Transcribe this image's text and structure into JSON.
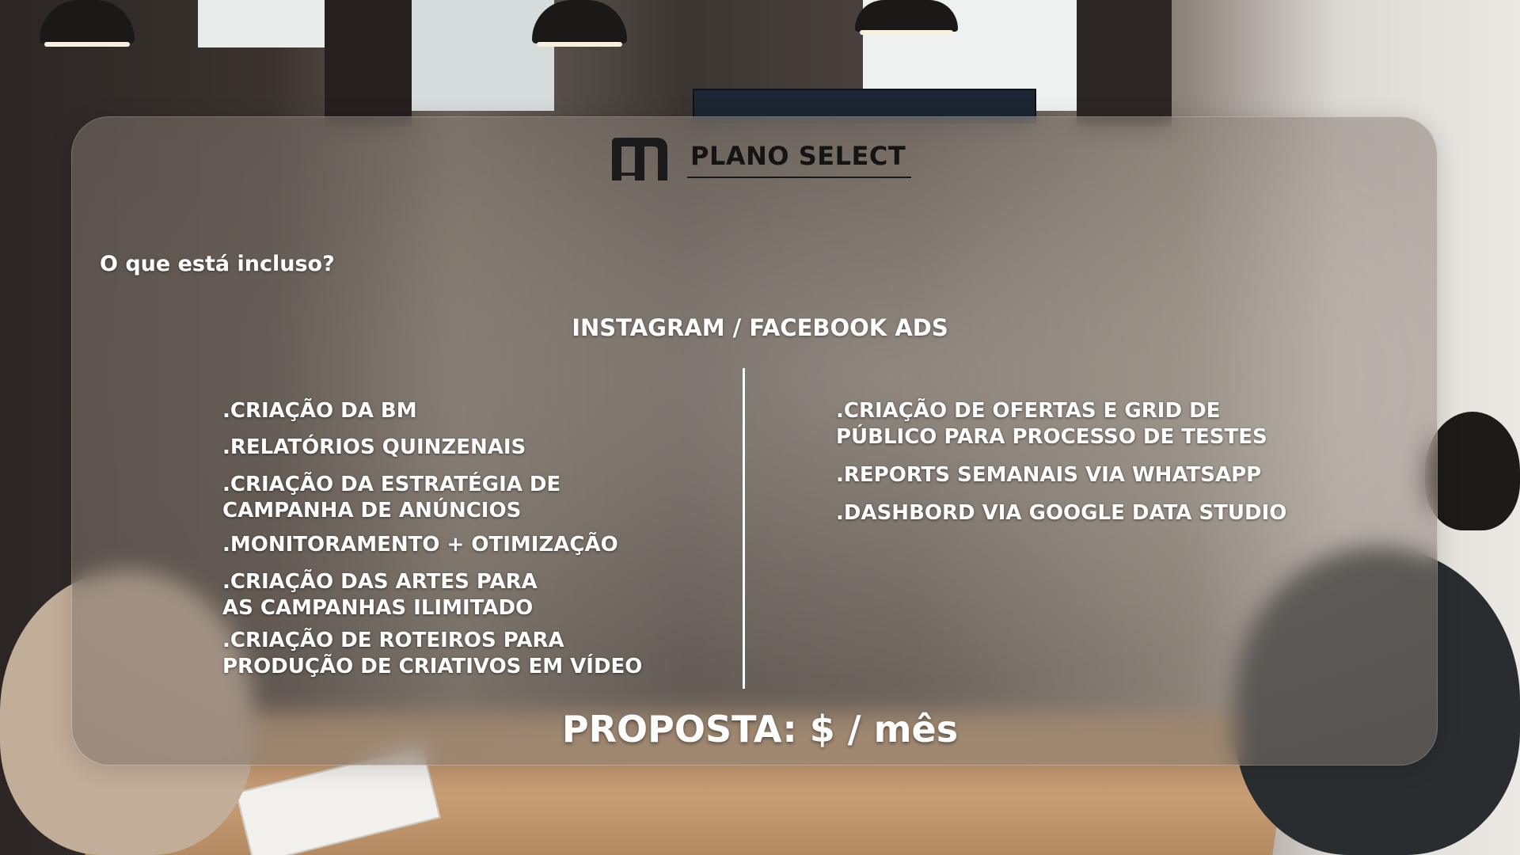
{
  "header": {
    "logo_icon": "m-brand-logo",
    "plan_title": "PLANO SELECT"
  },
  "intro": {
    "question": "O que está incluso?"
  },
  "section": {
    "title": "INSTAGRAM / FACEBOOK ADS"
  },
  "features_left": [
    ".CRIAÇÃO DA BM",
    ".RELATÓRIOS QUINZENAIS",
    ".CRIAÇÃO DA ESTRATÉGIA DE\nCAMPANHA DE ANÚNCIOS",
    ".MONITORAMENTO + OTIMIZAÇÃO",
    ".CRIAÇÃO DAS ARTES PARA\nAS CAMPANHAS ILIMITADO",
    ".CRIAÇÃO DE ROTEIROS PARA\nPRODUÇÃO DE CRIATIVOS EM VÍDEO"
  ],
  "features_right": [
    ".CRIAÇÃO DE OFERTAS E GRID DE\nPÚBLICO PARA PROCESSO DE TESTES",
    ".REPORTS SEMANAIS VIA WHATSAPP",
    ".DASHBORD VIA GOOGLE DATA STUDIO"
  ],
  "pricing": {
    "label": "PROPOSTA: $ / mês"
  },
  "colors": {
    "text": "#ffffff",
    "title": "#141414"
  }
}
